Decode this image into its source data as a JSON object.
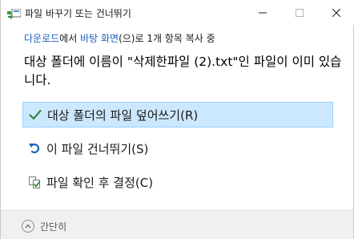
{
  "window": {
    "title": "파일 바꾸기 또는 건너뛰기"
  },
  "progress": {
    "prefix": "",
    "source": "다운로드",
    "mid1": "에서 ",
    "destination": "바탕 화면",
    "suffix": "(으)로 1개 항목 복사 중"
  },
  "message": "대상 폴더에 이름이 \"삭제한파일 (2).txt\"인 파일이 이미 있습니다.",
  "options": {
    "replace": "대상 폴더의 파일 덮어쓰기(R)",
    "skip": "이 파일 건너뛰기(S)",
    "decide": "파일 확인 후 결정(C)"
  },
  "footer": {
    "collapse_label": "간단히"
  },
  "colors": {
    "accent": "#1f5fbf",
    "selected_bg": "#cce8ff",
    "check": "#2e8b3d",
    "skip_arrow": "#1f5fbf"
  }
}
